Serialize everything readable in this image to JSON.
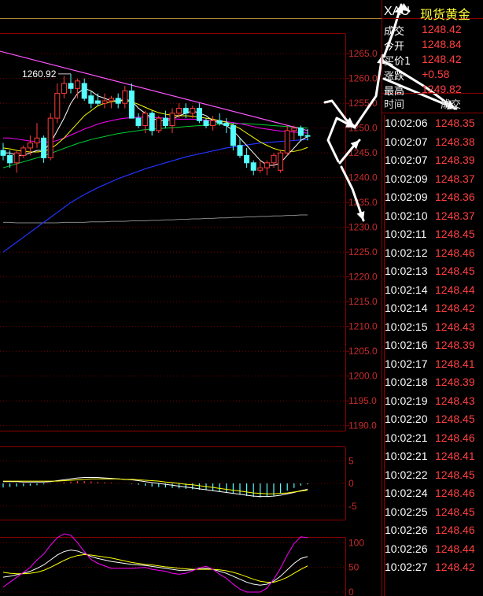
{
  "colors": {
    "grid": "#8b0000",
    "up_candle": "#ff3b3b",
    "down_candle": "#5ff",
    "axis_text": "#c62b2b",
    "price_text": "#ff4040",
    "time_text": "#ffffff",
    "ma5": "#ffffff",
    "ma10": "#ffff00",
    "ma20": "#ff00ff",
    "ma30": "#00cc33",
    "ma60": "#2233ff",
    "ma250": "#888888",
    "trendline": "#ff55ff",
    "arrows": "#ffffff"
  },
  "header": {
    "symbol": "XAU",
    "name": "现货黄金"
  },
  "quote": {
    "rows": [
      {
        "label": "成交",
        "value": "1248.42"
      },
      {
        "label": "今开",
        "value": "1248.84"
      },
      {
        "label": "买价1",
        "value": "1248.42"
      },
      {
        "label": "涨跌",
        "value": "+0.58"
      },
      {
        "label": "最高",
        "value": "1249.82"
      }
    ]
  },
  "ticks_header": {
    "time": "时间",
    "price": "成交"
  },
  "ticks": [
    {
      "time": "10:02:06",
      "price": "1248.35"
    },
    {
      "time": "10:02:07",
      "price": "1248.38"
    },
    {
      "time": "10:02:07",
      "price": "1248.39"
    },
    {
      "time": "10:02:09",
      "price": "1248.37"
    },
    {
      "time": "10:02:09",
      "price": "1248.36"
    },
    {
      "time": "10:02:10",
      "price": "1248.37"
    },
    {
      "time": "10:02:11",
      "price": "1248.45"
    },
    {
      "time": "10:02:12",
      "price": "1248.46"
    },
    {
      "time": "10:02:13",
      "price": "1248.45"
    },
    {
      "time": "10:02:14",
      "price": "1248.44"
    },
    {
      "time": "10:02:14",
      "price": "1248.42"
    },
    {
      "time": "10:02:15",
      "price": "1248.43"
    },
    {
      "time": "10:02:16",
      "price": "1248.39"
    },
    {
      "time": "10:02:17",
      "price": "1248.41"
    },
    {
      "time": "10:02:18",
      "price": "1248.39"
    },
    {
      "time": "10:02:19",
      "price": "1248.43"
    },
    {
      "time": "10:02:20",
      "price": "1248.45"
    },
    {
      "time": "10:02:21",
      "price": "1248.46"
    },
    {
      "time": "10:02:21",
      "price": "1248.41"
    },
    {
      "time": "10:02:22",
      "price": "1248.45"
    },
    {
      "time": "10:02:24",
      "price": "1248.46"
    },
    {
      "time": "10:02:25",
      "price": "1248.45"
    },
    {
      "time": "10:02:26",
      "price": "1248.46"
    },
    {
      "time": "10:02:26",
      "price": "1248.44"
    },
    {
      "time": "10:02:27",
      "price": "1248.42"
    }
  ],
  "chart_data": [
    {
      "type": "candlestick",
      "ylim": [
        1190,
        1268
      ],
      "y_ticks": [
        "1265.0",
        "1260.0",
        "1255.0",
        "1250.0",
        "1245.0",
        "1240.0",
        "1235.0",
        "1230.0",
        "1225.0",
        "1220.0",
        "1215.0",
        "1210.0",
        "1205.0",
        "1200.0",
        "1195.0",
        "1190.0"
      ],
      "y_tick_values": [
        1265,
        1260,
        1255,
        1250,
        1245,
        1240,
        1235,
        1230,
        1225,
        1220,
        1215,
        1210,
        1205,
        1200,
        1195,
        1190
      ],
      "annotation": "1260.92",
      "annotation_value": 1260.92,
      "candles": [
        {
          "o": 1245.5,
          "h": 1247.0,
          "l": 1243.5,
          "c": 1244.5
        },
        {
          "o": 1244.5,
          "h": 1245.5,
          "l": 1242.0,
          "c": 1243.0
        },
        {
          "o": 1243.0,
          "h": 1245.5,
          "l": 1241.0,
          "c": 1245.0
        },
        {
          "o": 1244.5,
          "h": 1246.5,
          "l": 1244.0,
          "c": 1246.0
        },
        {
          "o": 1246.0,
          "h": 1248.5,
          "l": 1244.5,
          "c": 1247.0
        },
        {
          "o": 1247.0,
          "h": 1251.0,
          "l": 1246.0,
          "c": 1248.0
        },
        {
          "o": 1248.0,
          "h": 1248.5,
          "l": 1243.0,
          "c": 1244.0
        },
        {
          "o": 1244.0,
          "h": 1253.0,
          "l": 1243.5,
          "c": 1252.0
        },
        {
          "o": 1252.0,
          "h": 1259.0,
          "l": 1251.0,
          "c": 1257.0
        },
        {
          "o": 1257.0,
          "h": 1260.5,
          "l": 1256.0,
          "c": 1259.0
        },
        {
          "o": 1259.0,
          "h": 1260.9,
          "l": 1257.0,
          "c": 1258.0
        },
        {
          "o": 1258.0,
          "h": 1260.0,
          "l": 1256.0,
          "c": 1259.5
        },
        {
          "o": 1259.0,
          "h": 1260.0,
          "l": 1255.5,
          "c": 1256.0
        },
        {
          "o": 1256.5,
          "h": 1257.5,
          "l": 1254.0,
          "c": 1255.0
        },
        {
          "o": 1255.5,
          "h": 1257.0,
          "l": 1254.5,
          "c": 1255.0
        },
        {
          "o": 1255.0,
          "h": 1257.0,
          "l": 1254.0,
          "c": 1255.5
        },
        {
          "o": 1255.5,
          "h": 1256.5,
          "l": 1254.0,
          "c": 1256.0
        },
        {
          "o": 1256.0,
          "h": 1257.0,
          "l": 1254.0,
          "c": 1255.0
        },
        {
          "o": 1255.0,
          "h": 1258.5,
          "l": 1254.0,
          "c": 1257.5
        },
        {
          "o": 1257.5,
          "h": 1259.0,
          "l": 1255.5,
          "c": 1252.0
        },
        {
          "o": 1252.0,
          "h": 1253.0,
          "l": 1250.0,
          "c": 1250.5
        },
        {
          "o": 1250.5,
          "h": 1253.5,
          "l": 1249.0,
          "c": 1253.0
        },
        {
          "o": 1253.0,
          "h": 1253.5,
          "l": 1248.5,
          "c": 1249.5
        },
        {
          "o": 1249.5,
          "h": 1252.5,
          "l": 1249.0,
          "c": 1252.0
        },
        {
          "o": 1252.0,
          "h": 1253.5,
          "l": 1250.0,
          "c": 1250.5
        },
        {
          "o": 1250.5,
          "h": 1254.0,
          "l": 1249.0,
          "c": 1253.0
        },
        {
          "o": 1253.0,
          "h": 1255.0,
          "l": 1252.0,
          "c": 1254.0
        },
        {
          "o": 1254.0,
          "h": 1255.0,
          "l": 1252.0,
          "c": 1253.0
        },
        {
          "o": 1253.0,
          "h": 1254.5,
          "l": 1252.0,
          "c": 1254.0
        },
        {
          "o": 1254.0,
          "h": 1255.0,
          "l": 1251.0,
          "c": 1251.5
        },
        {
          "o": 1251.5,
          "h": 1252.0,
          "l": 1250.0,
          "c": 1250.5
        },
        {
          "o": 1250.5,
          "h": 1252.5,
          "l": 1249.5,
          "c": 1251.5
        },
        {
          "o": 1251.5,
          "h": 1253.0,
          "l": 1250.5,
          "c": 1251.0
        },
        {
          "o": 1251.0,
          "h": 1252.0,
          "l": 1249.0,
          "c": 1250.5
        },
        {
          "o": 1250.5,
          "h": 1251.0,
          "l": 1245.5,
          "c": 1246.5
        },
        {
          "o": 1246.5,
          "h": 1248.0,
          "l": 1244.0,
          "c": 1244.5
        },
        {
          "o": 1244.5,
          "h": 1246.0,
          "l": 1242.0,
          "c": 1243.0
        },
        {
          "o": 1243.0,
          "h": 1243.5,
          "l": 1240.5,
          "c": 1241.5
        },
        {
          "o": 1241.5,
          "h": 1243.5,
          "l": 1241.0,
          "c": 1242.0
        },
        {
          "o": 1242.0,
          "h": 1243.5,
          "l": 1240.5,
          "c": 1243.0
        },
        {
          "o": 1243.0,
          "h": 1245.0,
          "l": 1242.0,
          "c": 1244.5
        },
        {
          "o": 1241.5,
          "h": 1245.5,
          "l": 1241.0,
          "c": 1245.0
        },
        {
          "o": 1245.0,
          "h": 1250.5,
          "l": 1244.5,
          "c": 1249.5
        },
        {
          "o": 1249.5,
          "h": 1250.5,
          "l": 1247.5,
          "c": 1250.0
        },
        {
          "o": 1250.0,
          "h": 1250.5,
          "l": 1247.5,
          "c": 1248.5
        },
        {
          "o": 1248.5,
          "h": 1249.8,
          "l": 1247.5,
          "c": 1248.4
        }
      ],
      "ma5": [
        1245,
        1245,
        1244.5,
        1244.5,
        1245,
        1245.5,
        1245.5,
        1247,
        1249.5,
        1252,
        1255,
        1257,
        1258,
        1257.5,
        1256.5,
        1256,
        1255.5,
        1255.5,
        1255.8,
        1255.5,
        1254,
        1253,
        1252,
        1251.5,
        1251.5,
        1251.8,
        1252.5,
        1253,
        1253.5,
        1253,
        1252.5,
        1251.5,
        1251,
        1250.5,
        1249.5,
        1248,
        1246.5,
        1245,
        1243.5,
        1242.5,
        1242.5,
        1243,
        1244.5,
        1246,
        1247.5,
        1248.3
      ],
      "ma10": [
        1246,
        1245.8,
        1245.5,
        1245.3,
        1245.2,
        1245.2,
        1245.3,
        1245.8,
        1246.8,
        1248,
        1249.5,
        1251,
        1252.5,
        1253.5,
        1254.5,
        1255,
        1255.3,
        1255.5,
        1255.5,
        1255.3,
        1254.8,
        1254.2,
        1253.6,
        1253.1,
        1252.8,
        1252.6,
        1252.5,
        1252.5,
        1252.4,
        1252.2,
        1252,
        1251.8,
        1251.5,
        1251.2,
        1250.6,
        1249.9,
        1249,
        1248.1,
        1247.2,
        1246.5,
        1245.9,
        1245.5,
        1245.3,
        1245.3,
        1245.6,
        1246.1
      ],
      "ma20": [
        1248,
        1248,
        1247.8,
        1247.6,
        1247.4,
        1247.3,
        1247.2,
        1247.2,
        1247.5,
        1248,
        1248.6,
        1249.2,
        1249.8,
        1250.3,
        1250.8,
        1251.2,
        1251.5,
        1251.8,
        1252,
        1252.1,
        1252.2,
        1252.2,
        1252.2,
        1252.1,
        1252,
        1251.9,
        1251.8,
        1251.8,
        1251.8,
        1251.7,
        1251.6,
        1251.5,
        1251.4,
        1251.3,
        1251.1,
        1250.9,
        1250.6,
        1250.3,
        1250,
        1249.8,
        1249.6,
        1249.4,
        1249.3,
        1249.2,
        1249.1,
        1249.0
      ],
      "ma30": [
        1242,
        1242.4,
        1242.8,
        1243.2,
        1243.6,
        1244,
        1244.4,
        1244.9,
        1245.4,
        1245.9,
        1246.4,
        1246.9,
        1247.3,
        1247.7,
        1248,
        1248.3,
        1248.6,
        1248.9,
        1249.1,
        1249.3,
        1249.5,
        1249.7,
        1249.8,
        1249.9,
        1250,
        1250.1,
        1250.2,
        1250.3,
        1250.4,
        1250.5,
        1250.6,
        1250.7,
        1250.8,
        1250.9,
        1250.9,
        1250.9,
        1250.9,
        1250.8,
        1250.7,
        1250.6,
        1250.5,
        1250.4,
        1250.3,
        1250.2,
        1250.1,
        1250.0
      ],
      "ma60": [
        1225,
        1226,
        1227,
        1228,
        1229,
        1230,
        1231,
        1232,
        1233,
        1234,
        1235,
        1235.8,
        1236.6,
        1237.3,
        1238,
        1238.6,
        1239.2,
        1239.8,
        1240.3,
        1240.8,
        1241.3,
        1241.8,
        1242.2,
        1242.6,
        1243,
        1243.4,
        1243.8,
        1244.2,
        1244.5,
        1244.8,
        1245.1,
        1245.4,
        1245.7,
        1246,
        1246.2,
        1246.4,
        1246.6,
        1246.8,
        1247,
        1247.1,
        1247.2,
        1247.3,
        1247.4,
        1247.5,
        1247.6,
        1247.7
      ],
      "ma250": [
        1231,
        1231,
        1230.9,
        1230.9,
        1230.9,
        1230.9,
        1230.9,
        1230.9,
        1230.9,
        1231,
        1231,
        1231,
        1231,
        1231.1,
        1231.1,
        1231.1,
        1231.2,
        1231.2,
        1231.2,
        1231.3,
        1231.3,
        1231.3,
        1231.4,
        1231.4,
        1231.5,
        1231.5,
        1231.6,
        1231.6,
        1231.7,
        1231.7,
        1231.8,
        1231.8,
        1231.9,
        1231.9,
        1232,
        1232,
        1232.1,
        1232.1,
        1232.2,
        1232.2,
        1232.3,
        1232.3,
        1232.4,
        1232.4,
        1232.5,
        1232.5
      ],
      "trendline": [
        [
          0,
          1265.5
        ],
        [
          45,
          1249.5
        ]
      ]
    },
    {
      "type": "bar",
      "name_indicator": "MACD",
      "ylim": [
        -8,
        8
      ],
      "y_ticks": [
        "5",
        "0",
        "-5"
      ],
      "y_tick_values": [
        5,
        0,
        -5
      ],
      "values": [
        -0.9,
        -0.8,
        -0.7,
        -0.6,
        -0.5,
        -0.4,
        -0.2,
        -0.05,
        0.1,
        0.25,
        0.4,
        0.5,
        0.5,
        0.45,
        0.35,
        0.25,
        0.15,
        0.05,
        0,
        -0.1,
        -0.3,
        -0.5,
        -0.7,
        -0.8,
        -0.9,
        -1,
        -1.1,
        -1.2,
        -1.3,
        -1.4,
        -1.5,
        -1.6,
        -1.8,
        -2,
        -2.2,
        -2.5,
        -2.8,
        -3,
        -3.1,
        -3,
        -2.7,
        -2.2,
        -1.6,
        -1,
        -0.5,
        -0.2
      ],
      "dif": [
        0.4,
        0.4,
        0.4,
        0.3,
        0.3,
        0.3,
        0.3,
        0.4,
        0.6,
        0.8,
        1.0,
        1.2,
        1.3,
        1.3,
        1.3,
        1.2,
        1.1,
        1.0,
        0.9,
        0.8,
        0.6,
        0.4,
        0.2,
        0.0,
        -0.2,
        -0.4,
        -0.6,
        -0.8,
        -1.0,
        -1.2,
        -1.4,
        -1.6,
        -1.8,
        -2.0,
        -2.2,
        -2.4,
        -2.6,
        -2.8,
        -2.9,
        -2.9,
        -2.8,
        -2.6,
        -2.3,
        -2.0,
        -1.6,
        -1.3
      ],
      "dea": [
        0.5,
        0.5,
        0.5,
        0.5,
        0.5,
        0.5,
        0.5,
        0.5,
        0.5,
        0.6,
        0.7,
        0.8,
        0.9,
        1.0,
        1.0,
        1.0,
        1.0,
        1.0,
        0.9,
        0.9,
        0.8,
        0.7,
        0.6,
        0.5,
        0.3,
        0.2,
        0.0,
        -0.2,
        -0.3,
        -0.5,
        -0.7,
        -0.9,
        -1.1,
        -1.3,
        -1.5,
        -1.7,
        -1.9,
        -2.1,
        -2.2,
        -2.3,
        -2.3,
        -2.2,
        -2.1,
        -1.9,
        -1.7,
        -1.5
      ]
    },
    {
      "type": "line",
      "name_indicator": "KDJ",
      "ylim": [
        0,
        110
      ],
      "y_ticks": [
        "100",
        "50",
        "0"
      ],
      "y_tick_values": [
        100,
        50,
        0
      ],
      "k": [
        30,
        32,
        35,
        38,
        42,
        48,
        55,
        65,
        75,
        82,
        85,
        83,
        78,
        72,
        68,
        65,
        62,
        60,
        58,
        56,
        55,
        54,
        52,
        50,
        48,
        46,
        44,
        44,
        45,
        47,
        48,
        46,
        42,
        38,
        32,
        26,
        20,
        16,
        14,
        16,
        22,
        32,
        45,
        58,
        68,
        72
      ],
      "d": [
        40,
        38,
        37,
        37,
        38,
        40,
        44,
        50,
        57,
        64,
        70,
        74,
        76,
        75,
        73,
        71,
        69,
        66,
        63,
        60,
        58,
        56,
        55,
        53,
        51,
        50,
        48,
        47,
        46,
        46,
        46,
        46,
        45,
        43,
        40,
        36,
        31,
        26,
        22,
        20,
        20,
        24,
        30,
        38,
        46,
        53
      ],
      "j": [
        10,
        20,
        30,
        40,
        50,
        65,
        77,
        95,
        110,
        118,
        115,
        100,
        82,
        66,
        58,
        53,
        48,
        48,
        48,
        48,
        49,
        50,
        46,
        44,
        42,
        38,
        36,
        38,
        43,
        49,
        52,
        46,
        36,
        28,
        16,
        6,
        0,
        0,
        0,
        8,
        26,
        48,
        75,
        98,
        112,
        110
      ]
    }
  ]
}
